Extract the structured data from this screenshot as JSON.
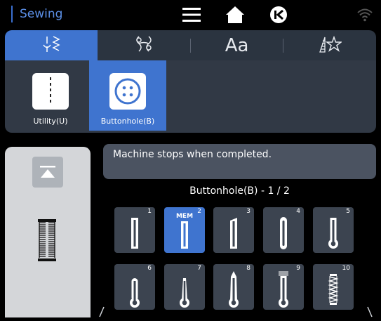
{
  "header": {
    "title": "Sewing",
    "icons": [
      "menu-icon",
      "home-icon",
      "back-icon",
      "wifi-icon"
    ]
  },
  "tabs": [
    {
      "icon": "utility-stitch-icon",
      "label": "",
      "active": true
    },
    {
      "icon": "decorative-stitch-icon",
      "label": "",
      "active": false
    },
    {
      "label": "Aa",
      "active": false
    },
    {
      "icon": "favorite-stitch-icon",
      "label": "",
      "active": false
    }
  ],
  "categories": [
    {
      "label": "Utility(U)",
      "icon": "straight-stitch-icon",
      "active": false
    },
    {
      "label": "Buttonhole(B)",
      "icon": "button-icon",
      "active": true
    }
  ],
  "message": "Machine stops when completed.",
  "page_label": "Buttonhole(B) - 1 / 2",
  "stitches": [
    {
      "number": "1",
      "mem": "",
      "active": false
    },
    {
      "number": "2",
      "mem": "MEM",
      "active": true
    },
    {
      "number": "3",
      "mem": "",
      "active": false
    },
    {
      "number": "4",
      "mem": "",
      "active": false
    },
    {
      "number": "5",
      "mem": "",
      "active": false
    },
    {
      "number": "6",
      "mem": "",
      "active": false
    },
    {
      "number": "7",
      "mem": "",
      "active": false
    },
    {
      "number": "8",
      "mem": "",
      "active": false
    },
    {
      "number": "9",
      "mem": "",
      "active": false
    },
    {
      "number": "10",
      "mem": "",
      "active": false
    }
  ],
  "colors": {
    "accent": "#3f74cf",
    "tile": "#3c4450",
    "panel": "#313945"
  }
}
